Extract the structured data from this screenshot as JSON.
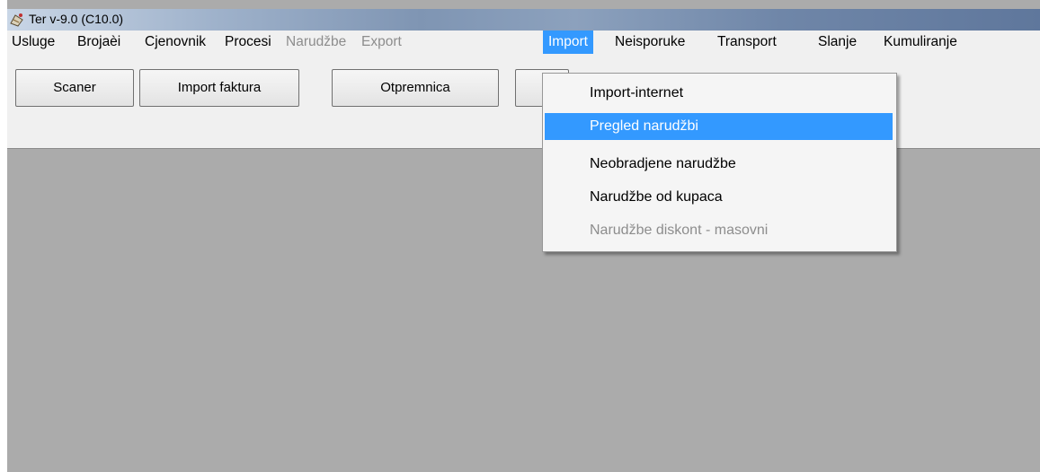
{
  "window": {
    "title": "Ter v-9.0  (C10.0)",
    "icon": "app-icon"
  },
  "menubar": {
    "items": [
      {
        "label": "Usluge",
        "state": "enabled"
      },
      {
        "label": "Brojaèi",
        "state": "enabled"
      },
      {
        "label": "Cjenovnik",
        "state": "enabled"
      },
      {
        "label": "Procesi",
        "state": "enabled"
      },
      {
        "label": "Narudžbe",
        "state": "disabled"
      },
      {
        "label": "Export",
        "state": "disabled"
      },
      {
        "label": "Import",
        "state": "active"
      },
      {
        "label": "Neisporuke",
        "state": "enabled"
      },
      {
        "label": "Transport",
        "state": "enabled"
      },
      {
        "label": "Slanje",
        "state": "enabled"
      },
      {
        "label": "Kumuliranje",
        "state": "enabled"
      }
    ]
  },
  "toolbar": {
    "buttons": [
      {
        "label": "Scaner"
      },
      {
        "label": "Import faktura"
      },
      {
        "label": "Otpremnica"
      },
      {
        "label": ""
      }
    ]
  },
  "import_menu": {
    "items": [
      {
        "label": "Import-internet",
        "state": "enabled"
      },
      {
        "label": "Pregled narudžbi",
        "state": "highlighted"
      },
      {
        "label": "Neobradjene narudžbe",
        "state": "enabled"
      },
      {
        "label": "Narudžbe od kupaca",
        "state": "enabled"
      },
      {
        "label": "Narudžbe diskont - masovni",
        "state": "disabled"
      }
    ]
  },
  "colors": {
    "highlight": "#3399ff",
    "workspace": "#ababab",
    "chrome": "#f0f0f0",
    "disabled_text": "#8d8d8d"
  }
}
